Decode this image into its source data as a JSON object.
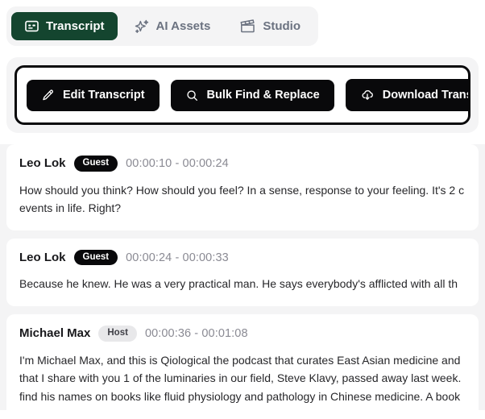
{
  "tabs": [
    {
      "label": "Transcript",
      "icon": "transcript-icon",
      "active": true
    },
    {
      "label": "AI Assets",
      "icon": "sparkle-icon",
      "active": false
    },
    {
      "label": "Studio",
      "icon": "clapperboard-icon",
      "active": false
    }
  ],
  "toolbar": {
    "edit_label": "Edit Transcript",
    "find_label": "Bulk Find & Replace",
    "download_label": "Download Transcript"
  },
  "colors": {
    "active_tab": "#14452f",
    "button": "#09090b",
    "page_bg": "#f4f4f5",
    "card": "#ffffff"
  },
  "transcript": [
    {
      "speaker": "Leo Lok",
      "role": "Guest",
      "time": "00:00:10 - 00:00:24",
      "lines": [
        "How should you think? How should you feel? In a sense, response to your feeling. It's 2 c",
        "events in life. Right?"
      ]
    },
    {
      "speaker": "Leo Lok",
      "role": "Guest",
      "time": "00:00:24 - 00:00:33",
      "lines": [
        "Because he knew. He was a very practical man. He says everybody's afflicted with all th"
      ]
    },
    {
      "speaker": "Michael Max",
      "role": "Host",
      "time": "00:00:36 - 00:01:08",
      "lines": [
        "I'm Michael Max, and this is Qiological the podcast that curates East Asian medicine and",
        "that I share with you 1 of the luminaries in our field, Steve Klavy, passed away last week.",
        "find his names on books like fluid physiology and pathology in Chinese medicine. A book"
      ]
    }
  ]
}
